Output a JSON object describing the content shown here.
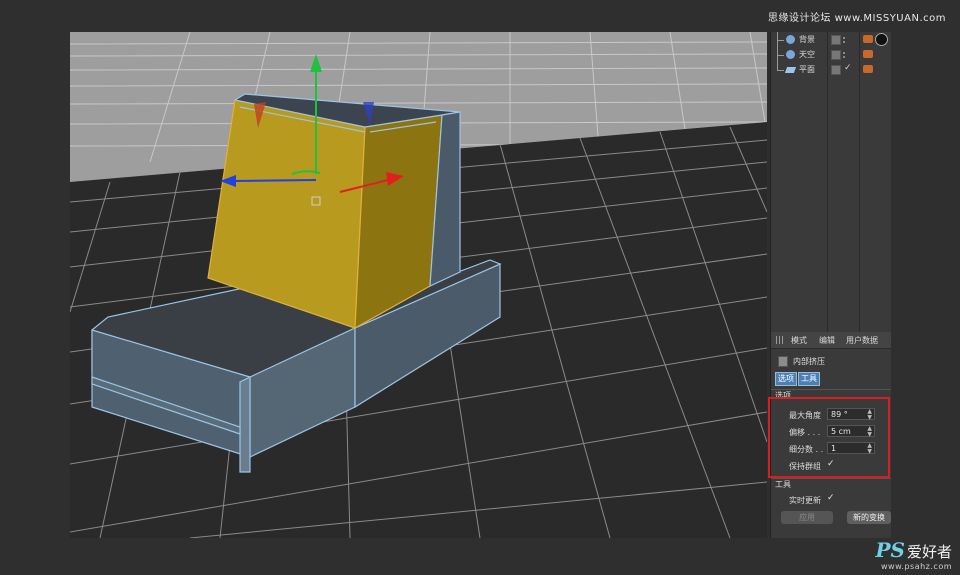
{
  "watermark": {
    "top": "思缘设计论坛 www.MISSYUAN.com",
    "logo": "PS",
    "cn": "爱好者",
    "url": "www.psahz.com"
  },
  "object_manager": {
    "items": [
      {
        "label": "背景",
        "icon": "background-object-icon"
      },
      {
        "label": "天空",
        "icon": "sky-object-icon"
      },
      {
        "label": "平面",
        "icon": "plane-object-icon"
      }
    ],
    "check": "✓"
  },
  "attributes": {
    "tabs": [
      "模式",
      "编辑",
      "用户数据"
    ],
    "tool_name": "内部挤压",
    "segments": [
      "选项",
      "工具"
    ],
    "section_options": "选项",
    "params": [
      {
        "label": "最大角度",
        "value": "89 °"
      },
      {
        "label": "偏移 . . .",
        "value": "5 cm"
      },
      {
        "label": "细分数 . .",
        "value": "1"
      }
    ],
    "preserve_groups_label": "保持群组",
    "preserve_groups_check": "✓",
    "section_tool": "工具",
    "realtime_label": "实时更新",
    "realtime_check": "✓",
    "apply_label": "应用",
    "new_transform_label": "新的变换"
  },
  "colors": {
    "highlight": "#d81e1e",
    "selected_face": "#b89a1e",
    "wireframe": "#9cc4e4",
    "x_axis": "#e02020",
    "y_axis": "#20c040",
    "z_axis": "#2040e0"
  }
}
